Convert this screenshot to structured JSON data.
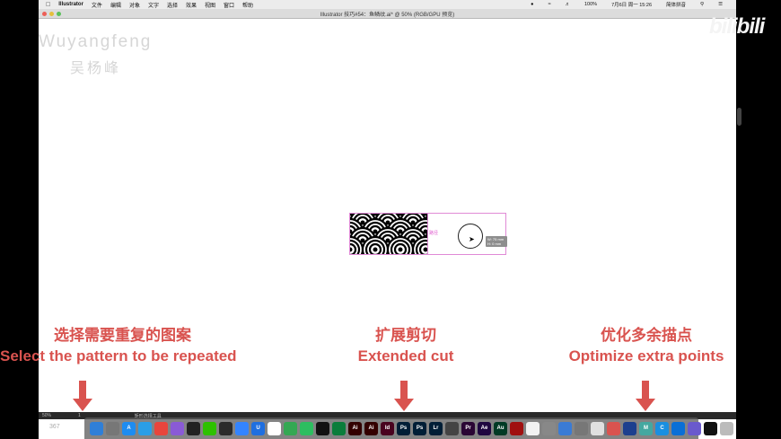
{
  "menubar": {
    "apple": "",
    "app": "Illustrator",
    "items": [
      "文件",
      "编辑",
      "对象",
      "文字",
      "选择",
      "效果",
      "视图",
      "窗口",
      "帮助"
    ],
    "right": [
      "100%",
      "7月6日 周一 15:26",
      "简体拼音"
    ]
  },
  "titlebar": {
    "title": "Illustrator 技巧#54：鱼鳞纹.ai* @ 50% (RGB/GPU 预览)"
  },
  "watermark": {
    "en": "Wuyangfeng",
    "cn": "吴杨峰"
  },
  "branding": {
    "logo": "bilibili",
    "small": ""
  },
  "canvas": {
    "guide_label": "路径",
    "tooltip_line1": "W: 75 mm",
    "tooltip_line2": "H: 0 mm"
  },
  "captions": [
    {
      "cn": "选择需要重复的图案",
      "en": "Select the pattern to be repeated"
    },
    {
      "cn": "扩展剪切",
      "en": "Extended cut"
    },
    {
      "cn": "优化多余描点",
      "en": "Optimize extra points"
    }
  ],
  "statusbar": {
    "zoom": "50%",
    "page": "1",
    "tool": "矩形选择工具"
  },
  "dock_number": "367",
  "dock": [
    {
      "name": "finder-icon",
      "label": "",
      "color": "#2f7fd8"
    },
    {
      "name": "launchpad-icon",
      "label": "",
      "color": "#777"
    },
    {
      "name": "appstore-icon",
      "label": "A",
      "color": "#1e8cf0"
    },
    {
      "name": "safari-icon",
      "label": "",
      "color": "#2a9ee6"
    },
    {
      "name": "chrome-icon",
      "label": "",
      "color": "#e8453c"
    },
    {
      "name": "pdf-icon",
      "label": "",
      "color": "#8a5ad6"
    },
    {
      "name": "qq-icon",
      "label": "",
      "color": "#222"
    },
    {
      "name": "wechat-icon",
      "label": "",
      "color": "#2dc100"
    },
    {
      "name": "evernote-icon",
      "label": "",
      "color": "#2b2b2b"
    },
    {
      "name": "baidu-icon",
      "label": "",
      "color": "#3384ff"
    },
    {
      "name": "u-icon",
      "label": "U",
      "color": "#1f6fe0"
    },
    {
      "name": "cloud-icon",
      "label": "",
      "color": "#ffffff"
    },
    {
      "name": "green-icon",
      "label": "",
      "color": "#34a853"
    },
    {
      "name": "evernote2-icon",
      "label": "",
      "color": "#2dbe60"
    },
    {
      "name": "pen-icon",
      "label": "",
      "color": "#111"
    },
    {
      "name": "green2-icon",
      "label": "",
      "color": "#0a7d3b"
    },
    {
      "name": "ai-icon",
      "label": "Ai",
      "color": "#330000"
    },
    {
      "name": "ai2-icon",
      "label": "Ai",
      "color": "#330000"
    },
    {
      "name": "id-icon",
      "label": "Id",
      "color": "#49021f"
    },
    {
      "name": "ps-icon",
      "label": "Ps",
      "color": "#001e36"
    },
    {
      "name": "ps2-icon",
      "label": "Ps",
      "color": "#001e36"
    },
    {
      "name": "lr-icon",
      "label": "Lr",
      "color": "#001e36"
    },
    {
      "name": "video-icon",
      "label": "",
      "color": "#444"
    },
    {
      "name": "pr-icon",
      "label": "Pr",
      "color": "#2a0634"
    },
    {
      "name": "ae-icon",
      "label": "Ae",
      "color": "#1f0740"
    },
    {
      "name": "au-icon",
      "label": "Au",
      "color": "#003a25"
    },
    {
      "name": "red-icon",
      "label": "",
      "color": "#a01010"
    },
    {
      "name": "photos-icon",
      "label": "",
      "color": "#f2f2f2"
    },
    {
      "name": "settings-icon",
      "label": "",
      "color": "#888"
    },
    {
      "name": "cube-icon",
      "label": "",
      "color": "#3a7bd5"
    },
    {
      "name": "tools-icon",
      "label": "",
      "color": "#777"
    },
    {
      "name": "sketch-icon",
      "label": "",
      "color": "#e0e0e0"
    },
    {
      "name": "star-icon",
      "label": "",
      "color": "#d9534f"
    },
    {
      "name": "c4d-icon",
      "label": "",
      "color": "#1c3f8e"
    },
    {
      "name": "m-icon",
      "label": "M",
      "color": "#44a8a0"
    },
    {
      "name": "c-icon",
      "label": "C",
      "color": "#1a8fe0"
    },
    {
      "name": "browser-icon",
      "label": "",
      "color": "#0a6fd6"
    },
    {
      "name": "window-icon",
      "label": "",
      "color": "#6a5acd"
    },
    {
      "name": "terminal-icon",
      "label": "",
      "color": "#111"
    },
    {
      "name": "trash-icon",
      "label": "",
      "color": "#bbb"
    }
  ]
}
